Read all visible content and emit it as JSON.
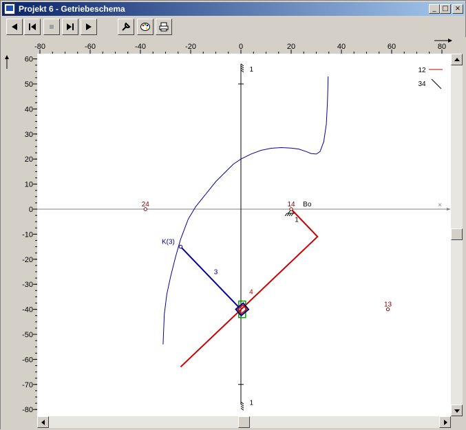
{
  "window": {
    "title": "Projekt 6 - Getriebeschema",
    "minimize_glyph": "_",
    "maximize_glyph": "□",
    "close_glyph": "×"
  },
  "toolbar": {
    "playback_buttons": [
      {
        "name": "play-backward-button",
        "icon": "play-left-icon"
      },
      {
        "name": "skip-to-start-button",
        "icon": "skip-start-icon"
      },
      {
        "name": "stop-button",
        "icon": "stop-icon"
      },
      {
        "name": "skip-to-end-button",
        "icon": "skip-end-icon"
      },
      {
        "name": "play-forward-button",
        "icon": "play-right-icon"
      }
    ],
    "tool_buttons": [
      {
        "name": "settings-tool-button",
        "icon": "wrench-icon"
      },
      {
        "name": "color-palette-button",
        "icon": "palette-icon"
      },
      {
        "name": "print-button",
        "icon": "printer-icon"
      }
    ]
  },
  "chart_data": {
    "type": "scatter",
    "x_ticks": [
      "-80",
      "-60",
      "-40",
      "-20",
      "0",
      "20",
      "40",
      "60",
      "80"
    ],
    "y_ticks": [
      "60",
      "50",
      "40",
      "30",
      "20",
      "10",
      "0",
      "-10",
      "-20",
      "-30",
      "-40",
      "-50",
      "-60",
      "-70",
      "-80"
    ],
    "xlim": [
      -81,
      81
    ],
    "ylim": [
      -81,
      61
    ],
    "blue_curve": [
      [
        -31,
        -54
      ],
      [
        -30.5,
        -42
      ],
      [
        -29.5,
        -34
      ],
      [
        -28,
        -27
      ],
      [
        -26,
        -19
      ],
      [
        -24,
        -12
      ],
      [
        -21,
        -4
      ],
      [
        -18,
        1
      ],
      [
        -14,
        6
      ],
      [
        -10,
        11
      ],
      [
        -6,
        15
      ],
      [
        -3,
        18
      ],
      [
        0,
        20
      ],
      [
        4,
        22
      ],
      [
        8,
        23.5
      ],
      [
        12,
        24.3
      ],
      [
        16,
        24.6
      ],
      [
        20,
        24.4
      ],
      [
        23,
        24
      ],
      [
        26,
        23
      ],
      [
        28,
        22.2
      ],
      [
        30,
        22
      ],
      [
        31.5,
        23
      ],
      [
        33,
        27
      ],
      [
        34,
        34
      ],
      [
        34.4,
        42
      ],
      [
        34.6,
        48
      ],
      [
        34.7,
        53
      ]
    ],
    "red_links": [
      [
        [
          20,
          0
        ],
        [
          30.5,
          -11
        ],
        [
          -24,
          -63
        ]
      ]
    ],
    "blue_link": [
      [
        -24,
        -15
      ],
      [
        -1,
        -39
      ]
    ],
    "labels": [
      {
        "text": "24",
        "x": -38,
        "y": 0,
        "color": "#800000"
      },
      {
        "text": "14",
        "x": 20,
        "y": 0,
        "color": "#800000"
      },
      {
        "text": "Bo",
        "x": 22,
        "y": 0,
        "color": "#000000"
      },
      {
        "text": "1",
        "x": 20,
        "y": -4,
        "color": "#000000"
      },
      {
        "text": "K(3)",
        "x": -24,
        "y": -15,
        "color": "#000080"
      },
      {
        "text": "3",
        "x": -10,
        "y": -26,
        "color": "#000080"
      },
      {
        "text": "4",
        "x": 3,
        "y": -35,
        "color": "#c00000"
      },
      {
        "text": "13",
        "x": 58.5,
        "y": -40,
        "color": "#800000"
      },
      {
        "text": "1",
        "x": 2,
        "y": 56,
        "color": "#000000"
      },
      {
        "text": "1",
        "x": 2,
        "y": -77,
        "color": "#000000"
      }
    ],
    "legend": [
      {
        "text": "12",
        "style": "horizontal"
      },
      {
        "text": "34",
        "style": "diagonal"
      }
    ],
    "colors": {
      "blue": "#0000a0",
      "red": "#cc0000",
      "green": "#00a000",
      "dark_red": "#800000"
    }
  }
}
